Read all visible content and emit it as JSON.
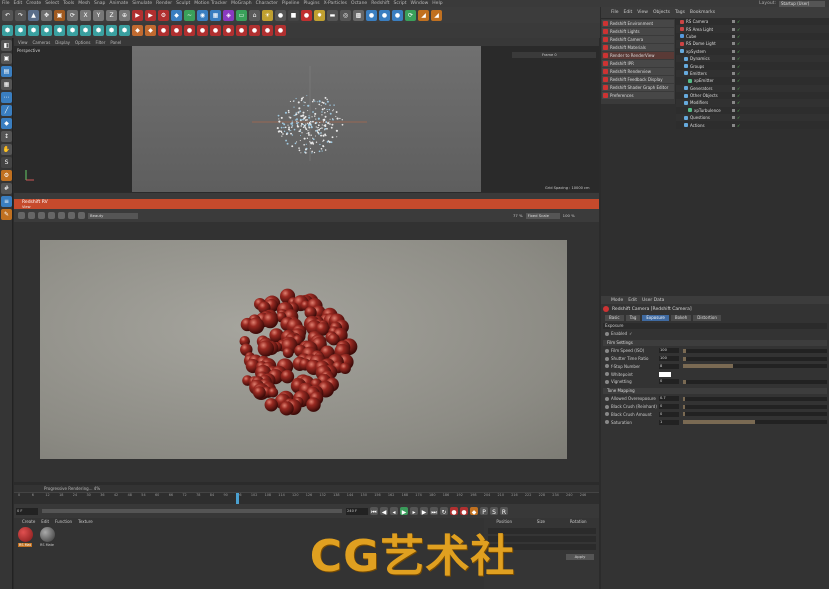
{
  "menubar": {
    "items": [
      "File",
      "Edit",
      "Create",
      "Select",
      "Tools",
      "Mesh",
      "Snap",
      "Animate",
      "Simulate",
      "Render",
      "Sculpt",
      "Motion Tracker",
      "MoGraph",
      "Character",
      "Pipeline",
      "Plugins",
      "X-Particles",
      "Octane",
      "Redshift",
      "Script",
      "Window",
      "Help"
    ],
    "layout_label": "Layout:",
    "layout_value": "Startup (User)"
  },
  "viewport": {
    "menu": [
      "View",
      "Cameras",
      "Display",
      "Options",
      "Filter",
      "Panel"
    ],
    "name": "Perspective",
    "grid_spacing": "Grid Spacing : 10000 cm",
    "frame_label": "Frame 0"
  },
  "renderview": {
    "title": "Redshift RV",
    "menu": [
      "View"
    ],
    "dropdown": "Beauty",
    "zoom": "77 %",
    "fit": "Fixed Scale",
    "pct": "100 %",
    "status": "Progressive Rendering... 4%"
  },
  "timeline": {
    "ticks": [
      "0",
      "6",
      "12",
      "18",
      "24",
      "30",
      "36",
      "42",
      "48",
      "54",
      "60",
      "66",
      "72",
      "78",
      "84",
      "90",
      "96",
      "102",
      "108",
      "114",
      "120",
      "126",
      "132",
      "138",
      "144",
      "150",
      "156",
      "162",
      "168",
      "174",
      "180",
      "186",
      "192",
      "198",
      "204",
      "210",
      "216",
      "222",
      "228",
      "234",
      "240",
      "246"
    ],
    "current": "90 F",
    "start": "0 F",
    "end": "240 F"
  },
  "material_panel": {
    "menu": [
      "Create",
      "Edit",
      "Function",
      "Texture"
    ],
    "materials": [
      {
        "name": "RS Mat"
      },
      {
        "name": "RS Mate"
      }
    ]
  },
  "coord_panel": {
    "headers": [
      "Position",
      "Size",
      "Rotation"
    ],
    "apply": "Apply"
  },
  "redshift_menu": {
    "items": [
      "Redshift Environment",
      "Redshift Lights",
      "Redshift Camera",
      "Redshift Materials",
      "Render to RenderView",
      "Redshift IPR",
      "Redshift Renderview",
      "Redshift Feedback Display",
      "Redshift Shader Graph Editor",
      "Preferences"
    ]
  },
  "object_manager": {
    "menu": [
      "File",
      "Edit",
      "View",
      "Objects",
      "Tags",
      "Bookmarks"
    ],
    "rows": [
      {
        "label": "RS Camera",
        "color": "#cc4444",
        "indent": 0
      },
      {
        "label": "RS Area Light",
        "color": "#cc4444",
        "indent": 0
      },
      {
        "label": "Cube",
        "color": "#5599dd",
        "indent": 0
      },
      {
        "label": "RS Dome Light",
        "color": "#cc4444",
        "indent": 0
      },
      {
        "label": "xpSystem",
        "color": "#66aadd",
        "indent": 0
      },
      {
        "label": "Dynamics",
        "color": "#66aadd",
        "indent": 1
      },
      {
        "label": "Groups",
        "color": "#66aadd",
        "indent": 1
      },
      {
        "label": "Emitters",
        "color": "#66aadd",
        "indent": 1
      },
      {
        "label": "xpEmitter",
        "color": "#55bb88",
        "indent": 2
      },
      {
        "label": "Generators",
        "color": "#66aadd",
        "indent": 1
      },
      {
        "label": "Other Objects",
        "color": "#66aadd",
        "indent": 1
      },
      {
        "label": "Modifiers",
        "color": "#66aadd",
        "indent": 1
      },
      {
        "label": "xpTurbulence",
        "color": "#55bb88",
        "indent": 2
      },
      {
        "label": "Questions",
        "color": "#66aadd",
        "indent": 1
      },
      {
        "label": "Actions",
        "color": "#66aadd",
        "indent": 1
      }
    ]
  },
  "attribute_manager": {
    "menu": [
      "Mode",
      "Edit",
      "User Data"
    ],
    "title": "Redshift Camera [Redshift Camera]",
    "tabs": [
      "Basic",
      "Tag",
      "Exposure",
      "Bokeh",
      "Distortion"
    ],
    "active_tab": "Exposure",
    "section": "Exposure",
    "enabled_label": "Enabled",
    "groups": [
      {
        "title": "Film Settings",
        "props": [
          {
            "label": "Film Speed (ISO)",
            "value": "100",
            "fill": 0.02
          },
          {
            "label": "Shutter Time Ratio",
            "value": "100",
            "fill": 0.02
          },
          {
            "label": "f-Stop Number",
            "value": "8",
            "fill": 0.35
          },
          {
            "label": "Whitepoint",
            "value": "",
            "fill": 0
          },
          {
            "label": "Vignetting",
            "value": "0",
            "fill": 0.02
          }
        ]
      },
      {
        "title": "Tone Mapping",
        "props": [
          {
            "label": "Allowed Overexposure",
            "value": "0.7",
            "fill": 0.0
          },
          {
            "label": "Black Crush (Reinhard)",
            "value": "0",
            "fill": 0.0
          },
          {
            "label": "Black Crush Amount",
            "value": "0",
            "fill": 0.0
          },
          {
            "label": "Saturation",
            "value": "1",
            "fill": 0.5
          }
        ]
      }
    ]
  },
  "watermark": "CG艺术社",
  "colors": {
    "accent": "#c64a2c",
    "tab_active": "#3f6aa1",
    "watermark": "#e0a020"
  }
}
